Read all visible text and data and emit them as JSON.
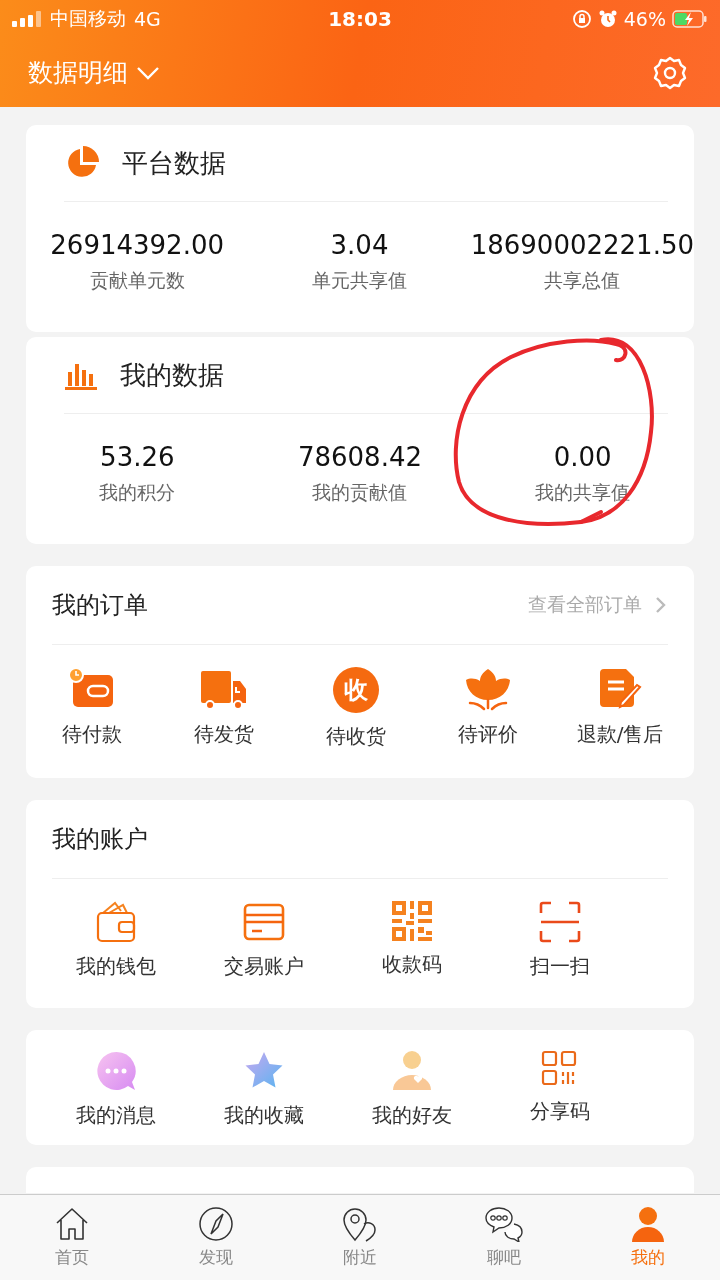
{
  "status_bar": {
    "carrier": "中国移动",
    "network": "4G",
    "time": "18:03",
    "battery": "46%"
  },
  "header": {
    "title": "数据明细"
  },
  "platform_data": {
    "title": "平台数据",
    "stats": [
      {
        "value": "26914392.00",
        "label": "贡献单元数"
      },
      {
        "value": "3.04",
        "label": "单元共享值"
      },
      {
        "value": "18690002221.50",
        "label": "共享总值"
      }
    ]
  },
  "my_data": {
    "title": "我的数据",
    "stats": [
      {
        "value": "53.26",
        "label": "我的积分",
        "circled": false
      },
      {
        "value": "78608.42",
        "label": "我的贡献值",
        "circled": false
      },
      {
        "value": "0.00",
        "label": "我的共享值",
        "circled": true
      }
    ]
  },
  "orders": {
    "title": "我的订单",
    "link": "查看全部订单",
    "items": [
      {
        "kind": "wallet",
        "label": "待付款"
      },
      {
        "kind": "truck",
        "label": "待发货"
      },
      {
        "kind": "receive",
        "label": "待收货",
        "glyph": "收"
      },
      {
        "kind": "flower",
        "label": "待评价"
      },
      {
        "kind": "note",
        "label": "退款/售后"
      }
    ]
  },
  "account": {
    "title": "我的账户",
    "items": [
      {
        "kind": "wallet-outline",
        "label": "我的钱包"
      },
      {
        "kind": "card",
        "label": "交易账户"
      },
      {
        "kind": "qr",
        "label": "收款码"
      },
      {
        "kind": "scan",
        "label": "扫一扫"
      }
    ]
  },
  "shortcuts": [
    {
      "kind": "message",
      "label": "我的消息"
    },
    {
      "kind": "star",
      "label": "我的收藏"
    },
    {
      "kind": "friend",
      "label": "我的好友"
    },
    {
      "kind": "share-code",
      "label": "分享码"
    }
  ],
  "tabs": [
    {
      "kind": "home",
      "label": "首页",
      "selected": false
    },
    {
      "kind": "discover",
      "label": "发现",
      "selected": false
    },
    {
      "kind": "nearby",
      "label": "附近",
      "selected": false
    },
    {
      "kind": "chat",
      "label": "聊吧",
      "selected": false
    },
    {
      "kind": "me",
      "label": "我的",
      "selected": true
    }
  ]
}
